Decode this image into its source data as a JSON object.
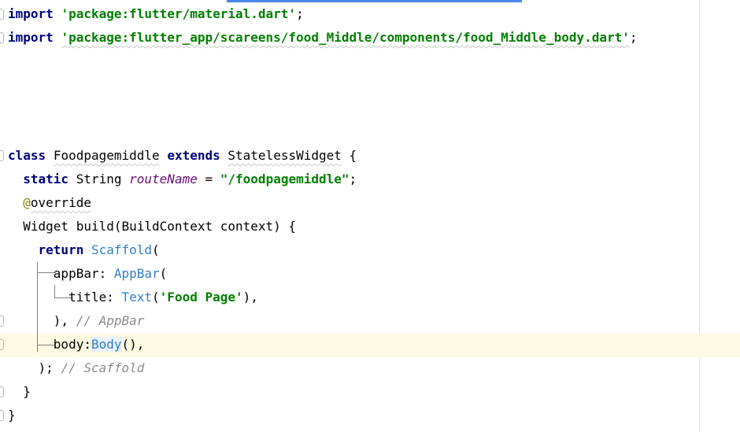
{
  "editor": {
    "lines": {
      "import1": {
        "kw": "import",
        "path": "'package:flutter/material.dart'",
        "end": ";"
      },
      "import2": {
        "kw": "import",
        "path": "'package:flutter_app/scareens/food_Middle/components/food_Middle_body.dart'",
        "end": ";"
      },
      "class_decl": {
        "kw_class": "class",
        "name": "Foodpagemiddle",
        "kw_extends": "extends",
        "parent": "StatelessWidget",
        "brace": "{"
      },
      "route": {
        "kw_static": "static",
        "type": "String",
        "field": "routeName",
        "eq": "=",
        "value": "\"/foodpagemiddle\"",
        "end": ";"
      },
      "override": {
        "at": "@",
        "name": "override"
      },
      "build": {
        "text": "Widget build(BuildContext context) {"
      },
      "return_line": {
        "kw": "return",
        "widget": "Scaffold",
        "paren": "("
      },
      "appbar": {
        "prop": "appBar: ",
        "widget": "AppBar",
        "paren": "("
      },
      "title": {
        "prop": "title: ",
        "widget": "Text",
        "open": "(",
        "value": "'Food Page'",
        "close": "),"
      },
      "appbar_close": {
        "text": "), ",
        "comment": "// AppBar"
      },
      "body": {
        "prop": "body:",
        "widget": "Body",
        "rest": "(),"
      },
      "scaffold_close": {
        "text": "); ",
        "comment": "// Scaffold"
      },
      "build_close": {
        "text": "}"
      },
      "class_close": {
        "text": "}"
      }
    }
  }
}
